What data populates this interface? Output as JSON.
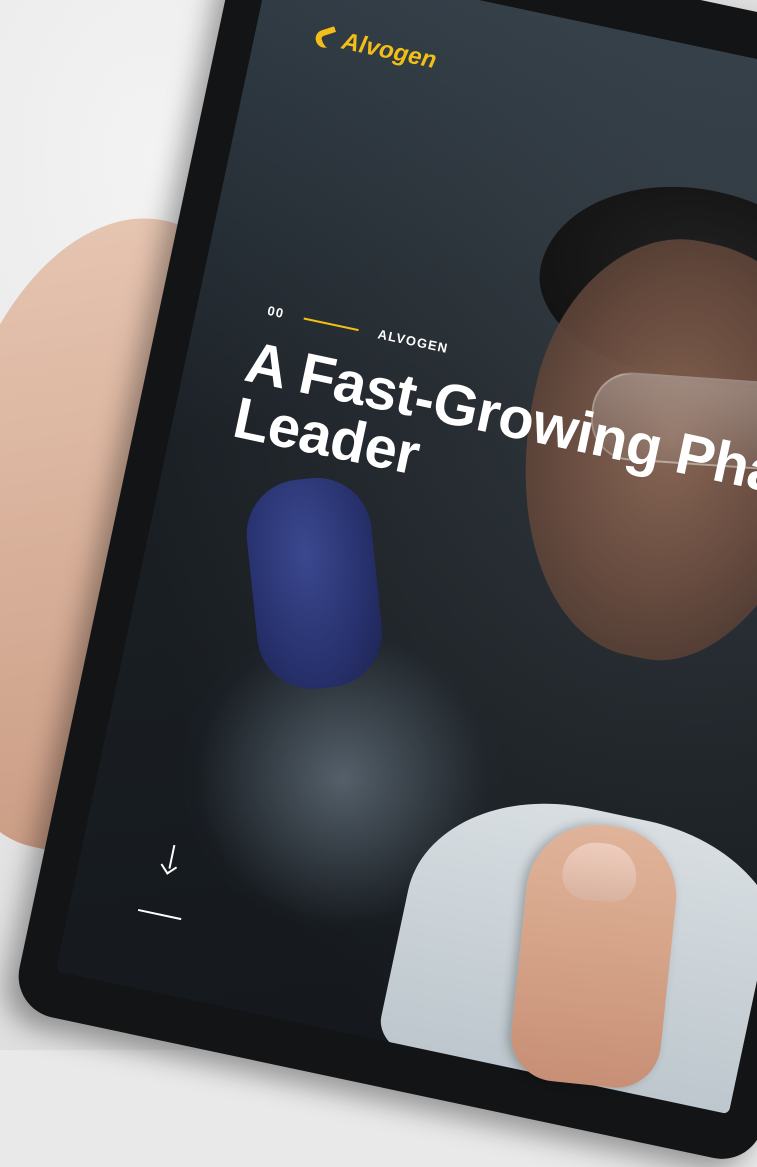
{
  "app": {
    "brand": {
      "logo_text": "Alvogen",
      "logo_icon": "alvogen-logo-icon"
    },
    "hero": {
      "index": "00",
      "kicker": "ALVOGEN",
      "title_line_1": "A Fast-Growing Pha",
      "title_line_2": "Leader"
    },
    "navigation": {
      "scroll_icon": "arrow-down-icon"
    }
  },
  "colors": {
    "accent": "#f3be17",
    "text": "#ffffff",
    "screen_dark": "#1b2228"
  }
}
